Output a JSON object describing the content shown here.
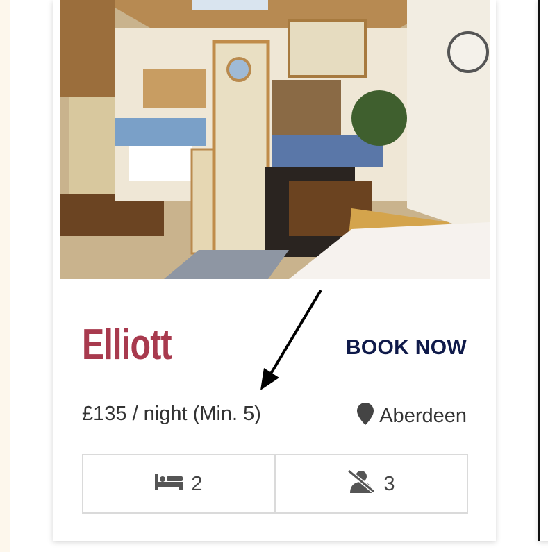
{
  "card": {
    "photo_alt": "",
    "title": "Elliott",
    "book_label": "BOOK NOW",
    "price": "£135 / night (Min. 5)",
    "location": "Aberdeen",
    "location_icon": "map-pin-icon",
    "stats": [
      {
        "icon": "bed-icon",
        "value": "2"
      },
      {
        "icon": "no-pets-icon",
        "value": "3"
      }
    ]
  },
  "colors": {
    "title": "#a83a4e",
    "book": "#0f1a4a",
    "text": "#333333",
    "border": "#dadada",
    "page_strip": "#fdf7ec"
  }
}
